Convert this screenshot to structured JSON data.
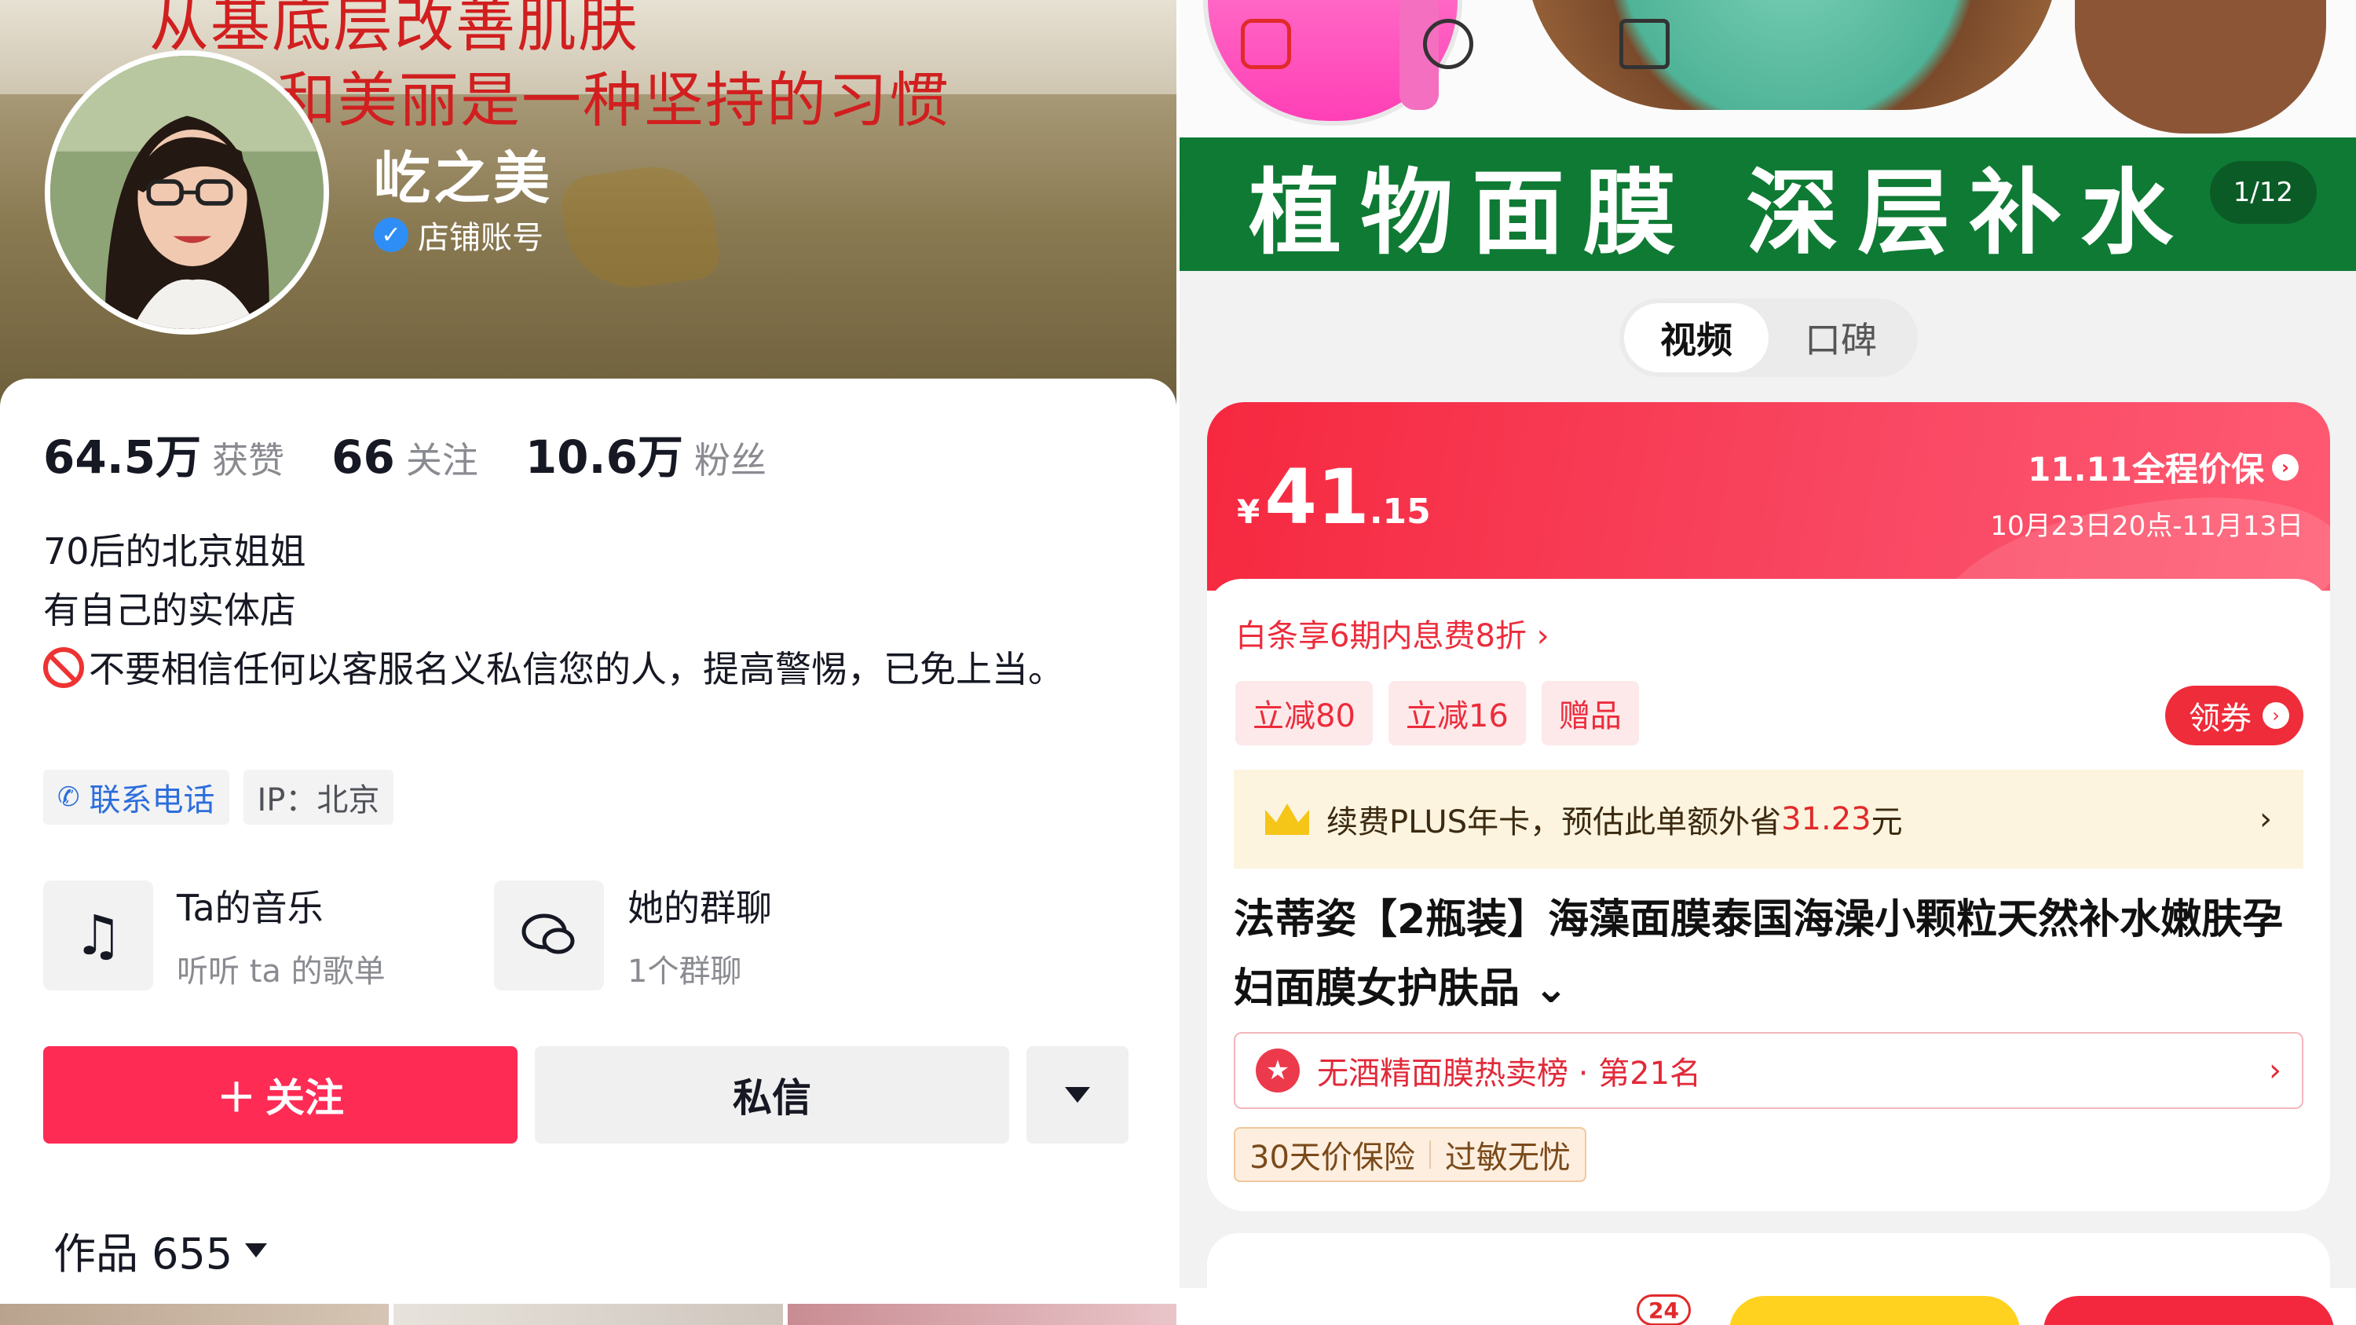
{
  "left": {
    "cover": {
      "line1": "从基底层改善肌肤",
      "line2": "和美丽是一种坚持的习惯"
    },
    "profile": {
      "nickname": "屹之美",
      "verified_label": "店铺账号"
    },
    "stats": [
      {
        "value": "64.5万",
        "label": "获赞"
      },
      {
        "value": "66",
        "label": "关注"
      },
      {
        "value": "10.6万",
        "label": "粉丝"
      }
    ],
    "bio": {
      "line1": "70后的北京姐姐",
      "line2": "有自己的实体店",
      "line3": "不要相信任何以客服名义私信您的人，提高警惕，已免上当。"
    },
    "tags": {
      "phone": "联系电话",
      "ip": "IP：北京"
    },
    "entries": [
      {
        "title": "Ta的音乐",
        "subtitle": "听听 ta 的歌单",
        "icon": "music-note-icon"
      },
      {
        "title": "她的群聊",
        "subtitle": "1个群聊",
        "icon": "chat-bubbles-icon"
      }
    ],
    "actions": {
      "follow": "关注",
      "message": "私信"
    },
    "works": {
      "label": "作品 655"
    }
  },
  "right": {
    "banner": {
      "text": "植物面膜  深层补水",
      "counter": "1/12"
    },
    "segment": {
      "tabs": [
        "视频",
        "口碑"
      ],
      "active": "视频"
    },
    "price": {
      "currency": "¥",
      "integer": "41",
      "decimal": ".15",
      "promo_title": "11.11全程价保",
      "promo_date": "10月23日20点-11月13日"
    },
    "baitiao": "白条享6期内息费8折 ›",
    "coupons": [
      "立减80",
      "立减16",
      "赠品"
    ],
    "coupon_button": "领券",
    "plus": {
      "prefix": "续费PLUS年卡，预估此单额外省",
      "amount": "31.23",
      "suffix": "元"
    },
    "product_title": "法蒂姿【2瓶装】海藻面膜泰国海澡小颗粒天然补水嫩肤孕妇面膜女护肤品 ⌄",
    "rank": "无酒精面膜热卖榜 · 第21名",
    "guarantee": [
      "30天价保险",
      "过敏无忧"
    ],
    "cart_badge": "24",
    "colors": {
      "follow_red": "#fe2c55",
      "jd_red": "#f6283f",
      "banner_green": "#0f7a34"
    }
  }
}
